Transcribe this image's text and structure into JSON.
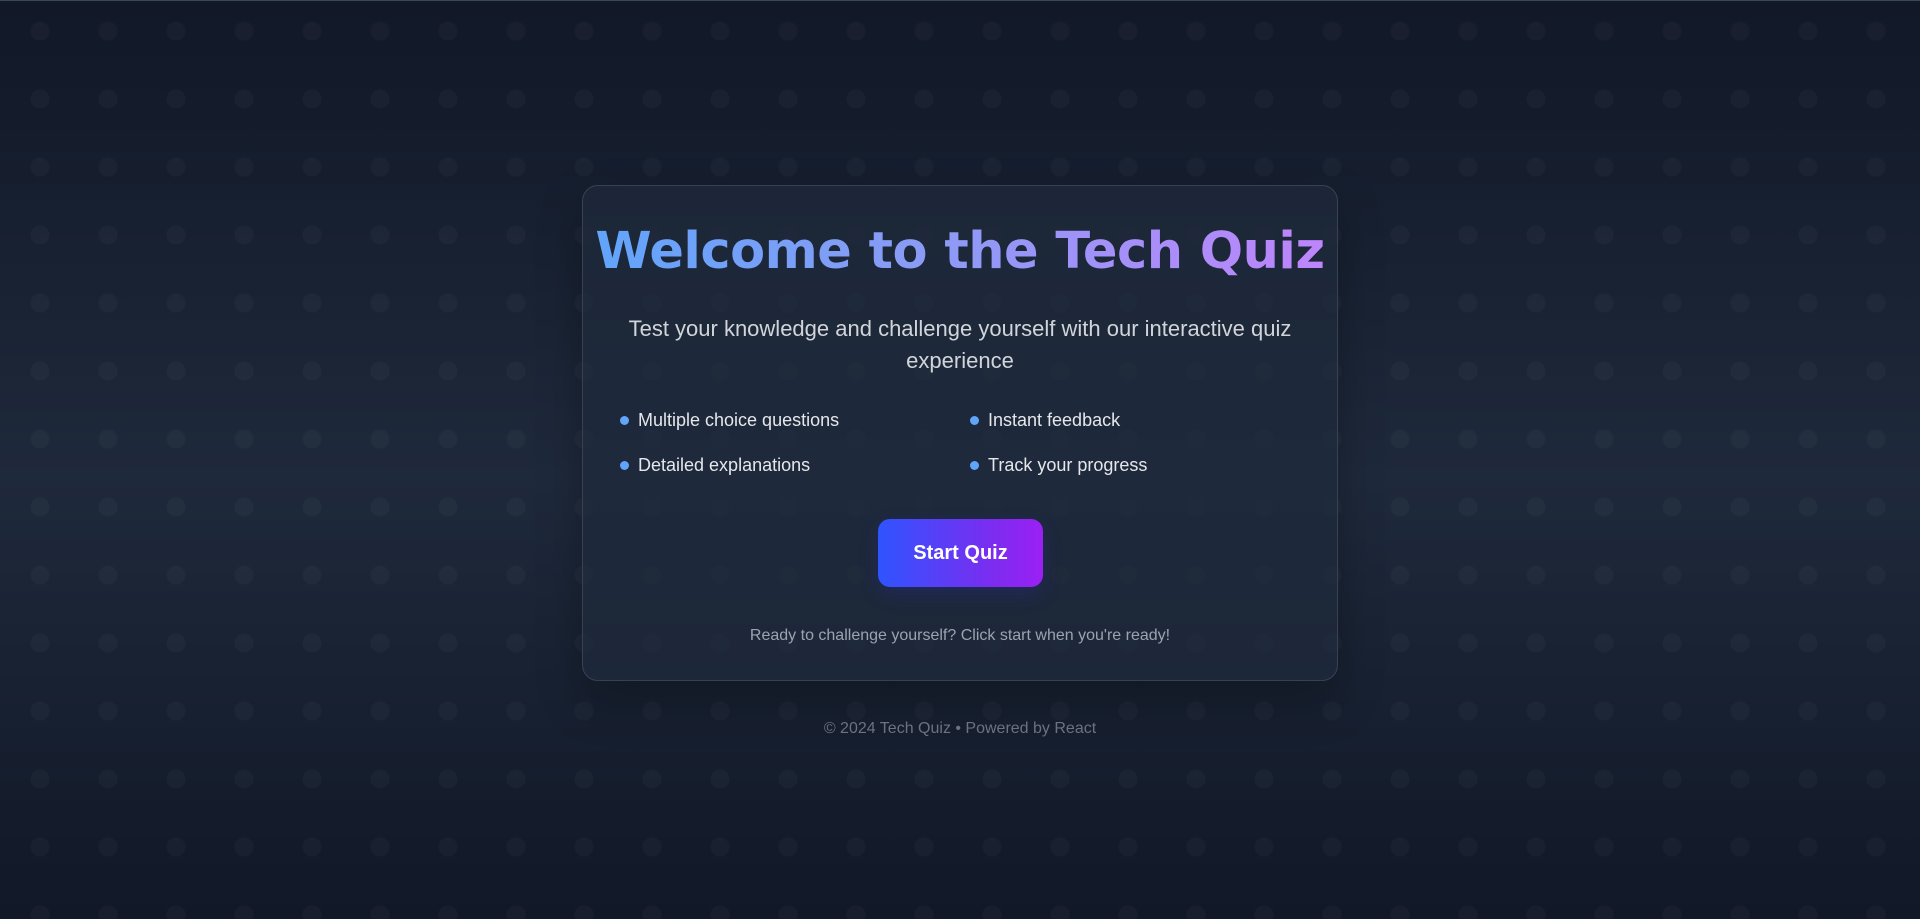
{
  "hero": {
    "title": "Welcome to the Tech Quiz",
    "subtitle": "Test your knowledge and challenge yourself with our interactive quiz experience"
  },
  "features": [
    {
      "label": "Multiple choice questions",
      "icon": "bullet-dot-icon"
    },
    {
      "label": "Instant feedback",
      "icon": "bullet-dot-icon"
    },
    {
      "label": "Detailed explanations",
      "icon": "bullet-dot-icon"
    },
    {
      "label": "Track your progress",
      "icon": "bullet-dot-icon"
    }
  ],
  "actions": {
    "start_label": "Start Quiz"
  },
  "hint": "Ready to challenge yourself? Click start when you're ready!",
  "footer": {
    "text": "© 2024 Tech Quiz • Powered by React"
  },
  "colors": {
    "background": "#111827",
    "card": "#1e293b",
    "accent_blue": "#60a5fa",
    "accent_purple": "#c084fc",
    "button_start": "#2f54ff",
    "button_end": "#9b20f4"
  }
}
